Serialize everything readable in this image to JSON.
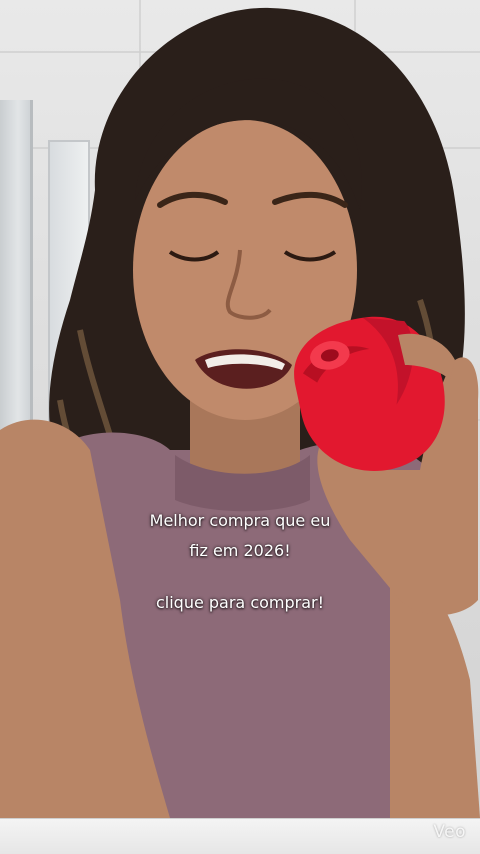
{
  "video": {
    "caption_line1": "Melhor compra que eu",
    "caption_line2": "fiz em 2026!",
    "caption_line3": "clique para comprar!",
    "watermark": "Veo"
  },
  "colors": {
    "top_color": "#8d6a78",
    "product_color": "#e2182f",
    "skin_color": "#b88566",
    "hair_color": "#2a1f1a"
  }
}
